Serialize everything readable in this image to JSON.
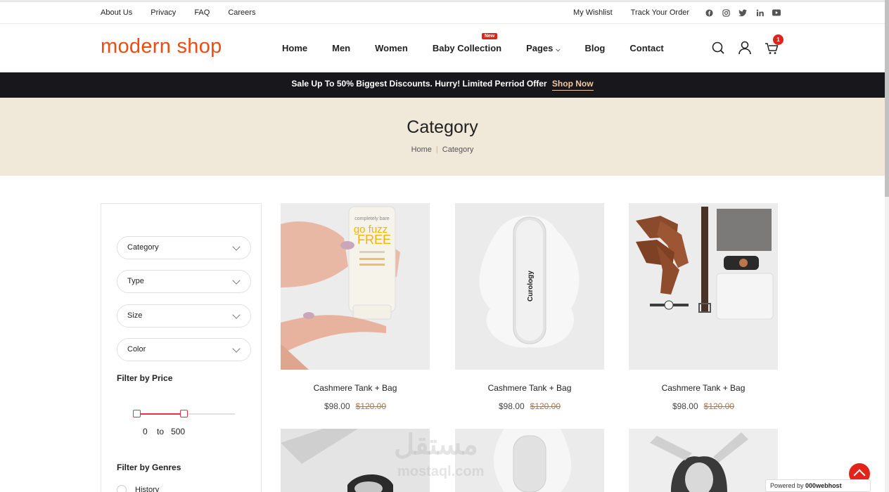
{
  "topbar": {
    "links": [
      "About Us",
      "Privacy",
      "FAQ",
      "Careers"
    ],
    "right_links": [
      "My Wishlist",
      "Track Your Order"
    ],
    "social": [
      "facebook-icon",
      "instagram-icon",
      "twitter-icon",
      "linkedin-icon",
      "youtube-icon"
    ]
  },
  "header": {
    "logo": "modern shop",
    "nav": [
      "Home",
      "Men",
      "Women",
      "Baby Collection",
      "Pages",
      "Blog",
      "Contact"
    ],
    "new_badge": "New",
    "cart_count": "1"
  },
  "promo": {
    "text": "Sale Up To 50% Biggest Discounts. Hurry! Limited Perriod Offer",
    "link": "Shop Now"
  },
  "hero": {
    "title": "Category",
    "breadcrumb_home": "Home",
    "breadcrumb_current": "Category"
  },
  "sidebar": {
    "selects": [
      "Category",
      "Type",
      "Size",
      "Color"
    ],
    "price_title": "Filter by Price",
    "price_from": "0",
    "price_to_word": "to",
    "price_to": "500",
    "genres_title": "Filter by Genres",
    "genre_first": "History"
  },
  "products": [
    {
      "name": "Cashmere Tank + Bag",
      "price": "$98.00",
      "old_price": "$120.00"
    },
    {
      "name": "Cashmere Tank + Bag",
      "price": "$98.00",
      "old_price": "$120.00"
    },
    {
      "name": "Cashmere Tank + Bag",
      "price": "$98.00",
      "old_price": "$120.00"
    }
  ],
  "product_image_labels": {
    "tube_brand": "completely bare",
    "tube_line1": "go fuzz",
    "tube_line2": "FREE",
    "bottle_brand": "Curology"
  },
  "watermark": {
    "arabic": "مستقل",
    "latin": "mostaql.com"
  },
  "powered": {
    "prefix": "Powered by",
    "brand": "000webhost"
  }
}
